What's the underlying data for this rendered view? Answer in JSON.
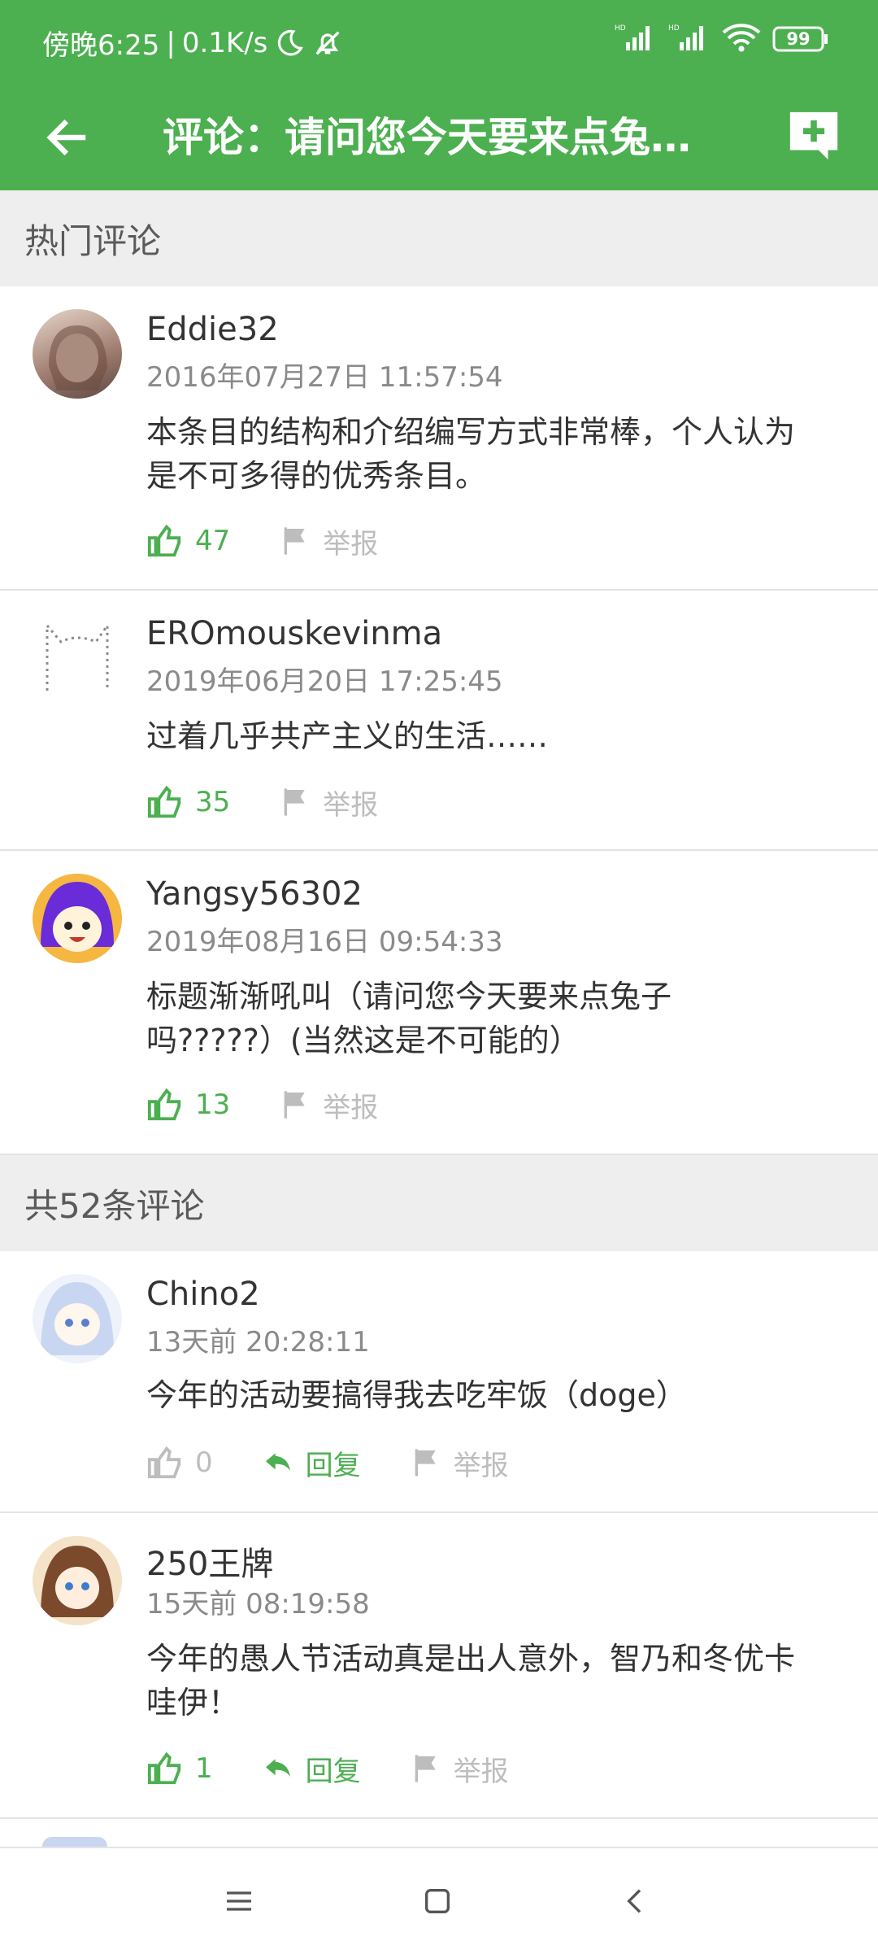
{
  "statusbar": {
    "time_text": "傍晚6:25",
    "separator": "|",
    "speed": "0.1K/s",
    "battery": "99"
  },
  "appbar": {
    "title": "评论：请问您今天要来点兔…"
  },
  "hot_section": {
    "label": "热门评论"
  },
  "all_section": {
    "label": "共52条评论"
  },
  "actions_text": {
    "reply": "回复",
    "report": "举报"
  },
  "comments": [
    {
      "user": "Eddie32",
      "time": "2016年07月27日 11:57:54",
      "text": "本条目的结构和介绍编写方式非常棒，个人认为是不可多得的优秀条目。",
      "likes": "47"
    },
    {
      "user": "EROmouskevinma",
      "time": "2019年06月20日 17:25:45",
      "text": "过着几乎共产主义的生活……",
      "likes": "35"
    },
    {
      "user": "Yangsy56302",
      "time": "2019年08月16日 09:54:33",
      "text": "标题渐渐吼叫（请问您今天要来点兔子吗?????）(当然这是不可能的）",
      "likes": "13"
    },
    {
      "user": "Chino2",
      "time": "13天前 20:28:11",
      "text": "今年的活动要搞得我去吃牢饭（doge）",
      "likes": "0"
    },
    {
      "user": "250王牌",
      "time": "15天前 08:19:58",
      "text": "今年的愚人节活动真是出人意外，智乃和冬优卡哇伊！",
      "likes": "1"
    }
  ],
  "colors": {
    "primary": "#4caf50",
    "section_bg": "#eeeeee",
    "muted": "#bdbdbd"
  }
}
